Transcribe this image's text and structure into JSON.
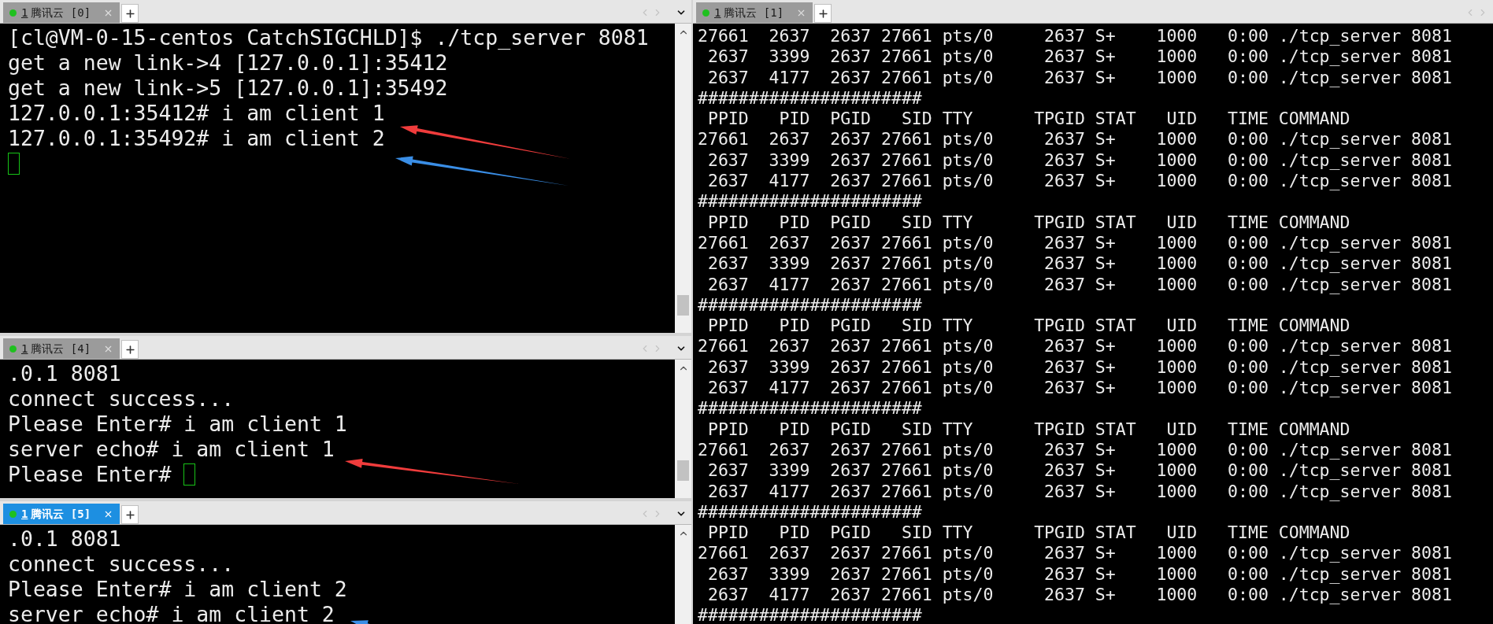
{
  "left_panes": [
    {
      "tab": {
        "number": "1",
        "label": "腾讯云 [0]",
        "focused": false
      },
      "lines": [
        {
          "text": "[cl@VM-0-15-centos CatchSIGCHLD]$ ./tcp_server 8081",
          "cursor": false
        },
        {
          "text": "get a new link->4 [127.0.0.1]:35412",
          "cursor": false
        },
        {
          "text": "get a new link->5 [127.0.0.1]:35492",
          "cursor": false
        },
        {
          "text": "127.0.0.1:35412# i am client 1",
          "cursor": false
        },
        {
          "text": "127.0.0.1:35492# i am client 2",
          "cursor": false
        },
        {
          "cursor": true
        }
      ],
      "arrows": [
        {
          "color": "#f03c3c"
        },
        {
          "color": "#3a8ee6"
        }
      ]
    },
    {
      "tab": {
        "number": "1",
        "label": "腾讯云 [4]",
        "focused": false
      },
      "lines": [
        {
          "text": ".0.1 8081",
          "cursor": false
        },
        {
          "text": "connect success...",
          "cursor": false
        },
        {
          "text": "Please Enter# i am client 1",
          "cursor": false
        },
        {
          "text": "server echo# i am client 1",
          "cursor": false
        },
        {
          "text": "Please Enter# ",
          "cursor": true
        }
      ],
      "arrows": [
        {
          "color": "#f03c3c"
        }
      ]
    },
    {
      "tab": {
        "number": "1",
        "label": "腾讯云 [5]",
        "focused": true
      },
      "lines": [
        {
          "text": ".0.1 8081",
          "cursor": false
        },
        {
          "text": "connect success...",
          "cursor": false
        },
        {
          "text": "Please Enter# i am client 2",
          "cursor": false
        },
        {
          "text": "server echo# i am client 2",
          "cursor": false
        }
      ],
      "arrows": [
        {
          "color": "#3a8ee6"
        }
      ]
    }
  ],
  "right_pane": {
    "tab": {
      "number": "1",
      "label": "腾讯云 [1]",
      "focused": false
    },
    "lines": [
      "27661  2637  2637 27661 pts/0     2637 S+    1000   0:00 ./tcp_server 8081",
      " 2637  3399  2637 27661 pts/0     2637 S+    1000   0:00 ./tcp_server 8081",
      " 2637  4177  2637 27661 pts/0     2637 S+    1000   0:00 ./tcp_server 8081",
      "######################",
      " PPID   PID  PGID   SID TTY      TPGID STAT   UID   TIME COMMAND",
      "27661  2637  2637 27661 pts/0     2637 S+    1000   0:00 ./tcp_server 8081",
      " 2637  3399  2637 27661 pts/0     2637 S+    1000   0:00 ./tcp_server 8081",
      " 2637  4177  2637 27661 pts/0     2637 S+    1000   0:00 ./tcp_server 8081",
      "######################",
      " PPID   PID  PGID   SID TTY      TPGID STAT   UID   TIME COMMAND",
      "27661  2637  2637 27661 pts/0     2637 S+    1000   0:00 ./tcp_server 8081",
      " 2637  3399  2637 27661 pts/0     2637 S+    1000   0:00 ./tcp_server 8081",
      " 2637  4177  2637 27661 pts/0     2637 S+    1000   0:00 ./tcp_server 8081",
      "######################",
      " PPID   PID  PGID   SID TTY      TPGID STAT   UID   TIME COMMAND",
      "27661  2637  2637 27661 pts/0     2637 S+    1000   0:00 ./tcp_server 8081",
      " 2637  3399  2637 27661 pts/0     2637 S+    1000   0:00 ./tcp_server 8081",
      " 2637  4177  2637 27661 pts/0     2637 S+    1000   0:00 ./tcp_server 8081",
      "######################",
      " PPID   PID  PGID   SID TTY      TPGID STAT   UID   TIME COMMAND",
      "27661  2637  2637 27661 pts/0     2637 S+    1000   0:00 ./tcp_server 8081",
      " 2637  3399  2637 27661 pts/0     2637 S+    1000   0:00 ./tcp_server 8081",
      " 2637  4177  2637 27661 pts/0     2637 S+    1000   0:00 ./tcp_server 8081",
      "######################",
      " PPID   PID  PGID   SID TTY      TPGID STAT   UID   TIME COMMAND",
      "27661  2637  2637 27661 pts/0     2637 S+    1000   0:00 ./tcp_server 8081",
      " 2637  3399  2637 27661 pts/0     2637 S+    1000   0:00 ./tcp_server 8081",
      " 2637  4177  2637 27661 pts/0     2637 S+    1000   0:00 ./tcp_server 8081",
      "######################"
    ]
  }
}
